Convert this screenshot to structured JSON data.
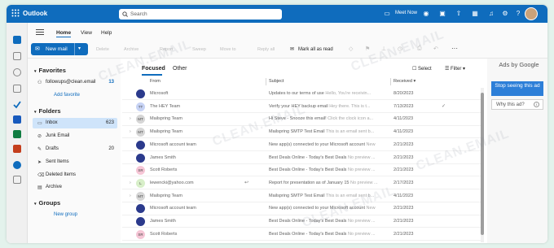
{
  "app": {
    "brand": "Outlook",
    "search_placeholder": "Search",
    "meet_now": "Meet Now"
  },
  "ribbon": {
    "tabs": [
      "Home",
      "View",
      "Help"
    ]
  },
  "toolbar": {
    "new_mail": "New mail",
    "disabled_actions": [
      "Delete",
      "Archive",
      "Report",
      "Sweep",
      "Move to",
      "Reply all"
    ],
    "mark_all_read": "Mark all as read"
  },
  "sidebar": {
    "favorites_label": "Favorites",
    "favorites": [
      {
        "label": "followups@clean.email",
        "count": "13"
      }
    ],
    "add_favorite": "Add favorite",
    "folders_label": "Folders",
    "folders": [
      {
        "label": "Inbox",
        "count": "623",
        "icon": "inbox-icon"
      },
      {
        "label": "Junk Email",
        "count": "",
        "icon": "junk-icon"
      },
      {
        "label": "Drafts",
        "count": "20",
        "icon": "pencil-icon"
      },
      {
        "label": "Sent Items",
        "count": "",
        "icon": "send-icon"
      },
      {
        "label": "Deleted Items",
        "count": "",
        "icon": "trash-icon"
      },
      {
        "label": "Archive",
        "count": "",
        "icon": "archive-icon"
      }
    ],
    "groups_label": "Groups",
    "new_group": "New group"
  },
  "mail": {
    "tabs": {
      "focused": "Focused",
      "other": "Other"
    },
    "select_label": "Select",
    "filter_label": "Filter",
    "columns": {
      "from": "From",
      "subject": "Subject",
      "received": "Received"
    },
    "rows": [
      {
        "from": "Microsoft",
        "subject": "Updates to our terms of use",
        "preview": "Hello, You're receivin...",
        "date": "8/20/2023",
        "avatar": "",
        "avatar_color": "#2b3a8c",
        "expand": false
      },
      {
        "from": "The HEY Team",
        "subject": "Verify your HEY backup email",
        "preview": "Hey there. This is t...",
        "date": "7/13/2023",
        "avatar": "TT",
        "avatar_color": "#c7d3f5",
        "expand": false
      },
      {
        "from": "Mailspring Team",
        "subject": "Hi Steve - Snooze this email!",
        "preview": "Click the clock icon a...",
        "date": "4/11/2023",
        "avatar": "MT",
        "avatar_color": "#d6d6d6",
        "expand": true
      },
      {
        "from": "Mailspring Team",
        "subject": "Mailspring SMTP Test Email",
        "preview": "This is an email sent b...",
        "date": "4/11/2023",
        "avatar": "MT",
        "avatar_color": "#d6d6d6",
        "expand": true
      },
      {
        "from": "Microsoft account team",
        "subject": "New app(s) connected to your Microsoft account",
        "preview": "New",
        "date": "2/21/2023",
        "avatar": "",
        "avatar_color": "#2b3a8c",
        "expand": false
      },
      {
        "from": "James Smith",
        "subject": "Best Deals Online - Today's Best Deals",
        "preview": "No preview ...",
        "date": "2/21/2023",
        "avatar": "",
        "avatar_color": "#2b3a8c",
        "expand": false
      },
      {
        "from": "Scott Roberts",
        "subject": "Best Deals Online - Today's Best Deals",
        "preview": "No preview ...",
        "date": "2/21/2023",
        "avatar": "SR",
        "avatar_color": "#f6c6d6",
        "expand": false
      },
      {
        "from": "lewencki@yahoo.com",
        "subject": "Report for presentation as of January 15",
        "preview": "No preview ...",
        "date": "2/17/2023",
        "avatar": "L",
        "avatar_color": "#d8efc9",
        "expand": true
      },
      {
        "from": "Mailspring Team",
        "subject": "Mailspring SMTP Test Email",
        "preview": "This is an email sent b...",
        "date": "4/11/2023",
        "avatar": "MT",
        "avatar_color": "#d6d6d6",
        "expand": true
      },
      {
        "from": "Microsoft account team",
        "subject": "New app(s) connected to your Microsoft account",
        "preview": "New",
        "date": "2/21/2023",
        "avatar": "",
        "avatar_color": "#2b3a8c",
        "expand": false
      },
      {
        "from": "James Smith",
        "subject": "Best Deals Online - Today's Best Deals",
        "preview": "No preview ...",
        "date": "2/21/2023",
        "avatar": "",
        "avatar_color": "#2b3a8c",
        "expand": false
      },
      {
        "from": "Scott Roberts",
        "subject": "Best Deals Online - Today's Best Deals",
        "preview": "No preview ...",
        "date": "2/21/2023",
        "avatar": "SR",
        "avatar_color": "#f6c6d6",
        "expand": false
      }
    ]
  },
  "ads": {
    "title": "Ads by Google",
    "stop": "Stop seeing this ad",
    "why": "Why this ad?"
  },
  "watermark": "CLEAN.EMAIL",
  "colors": {
    "accent": "#0f6cbd",
    "selected": "#cfe4fa",
    "background": "#e3f2ec"
  }
}
